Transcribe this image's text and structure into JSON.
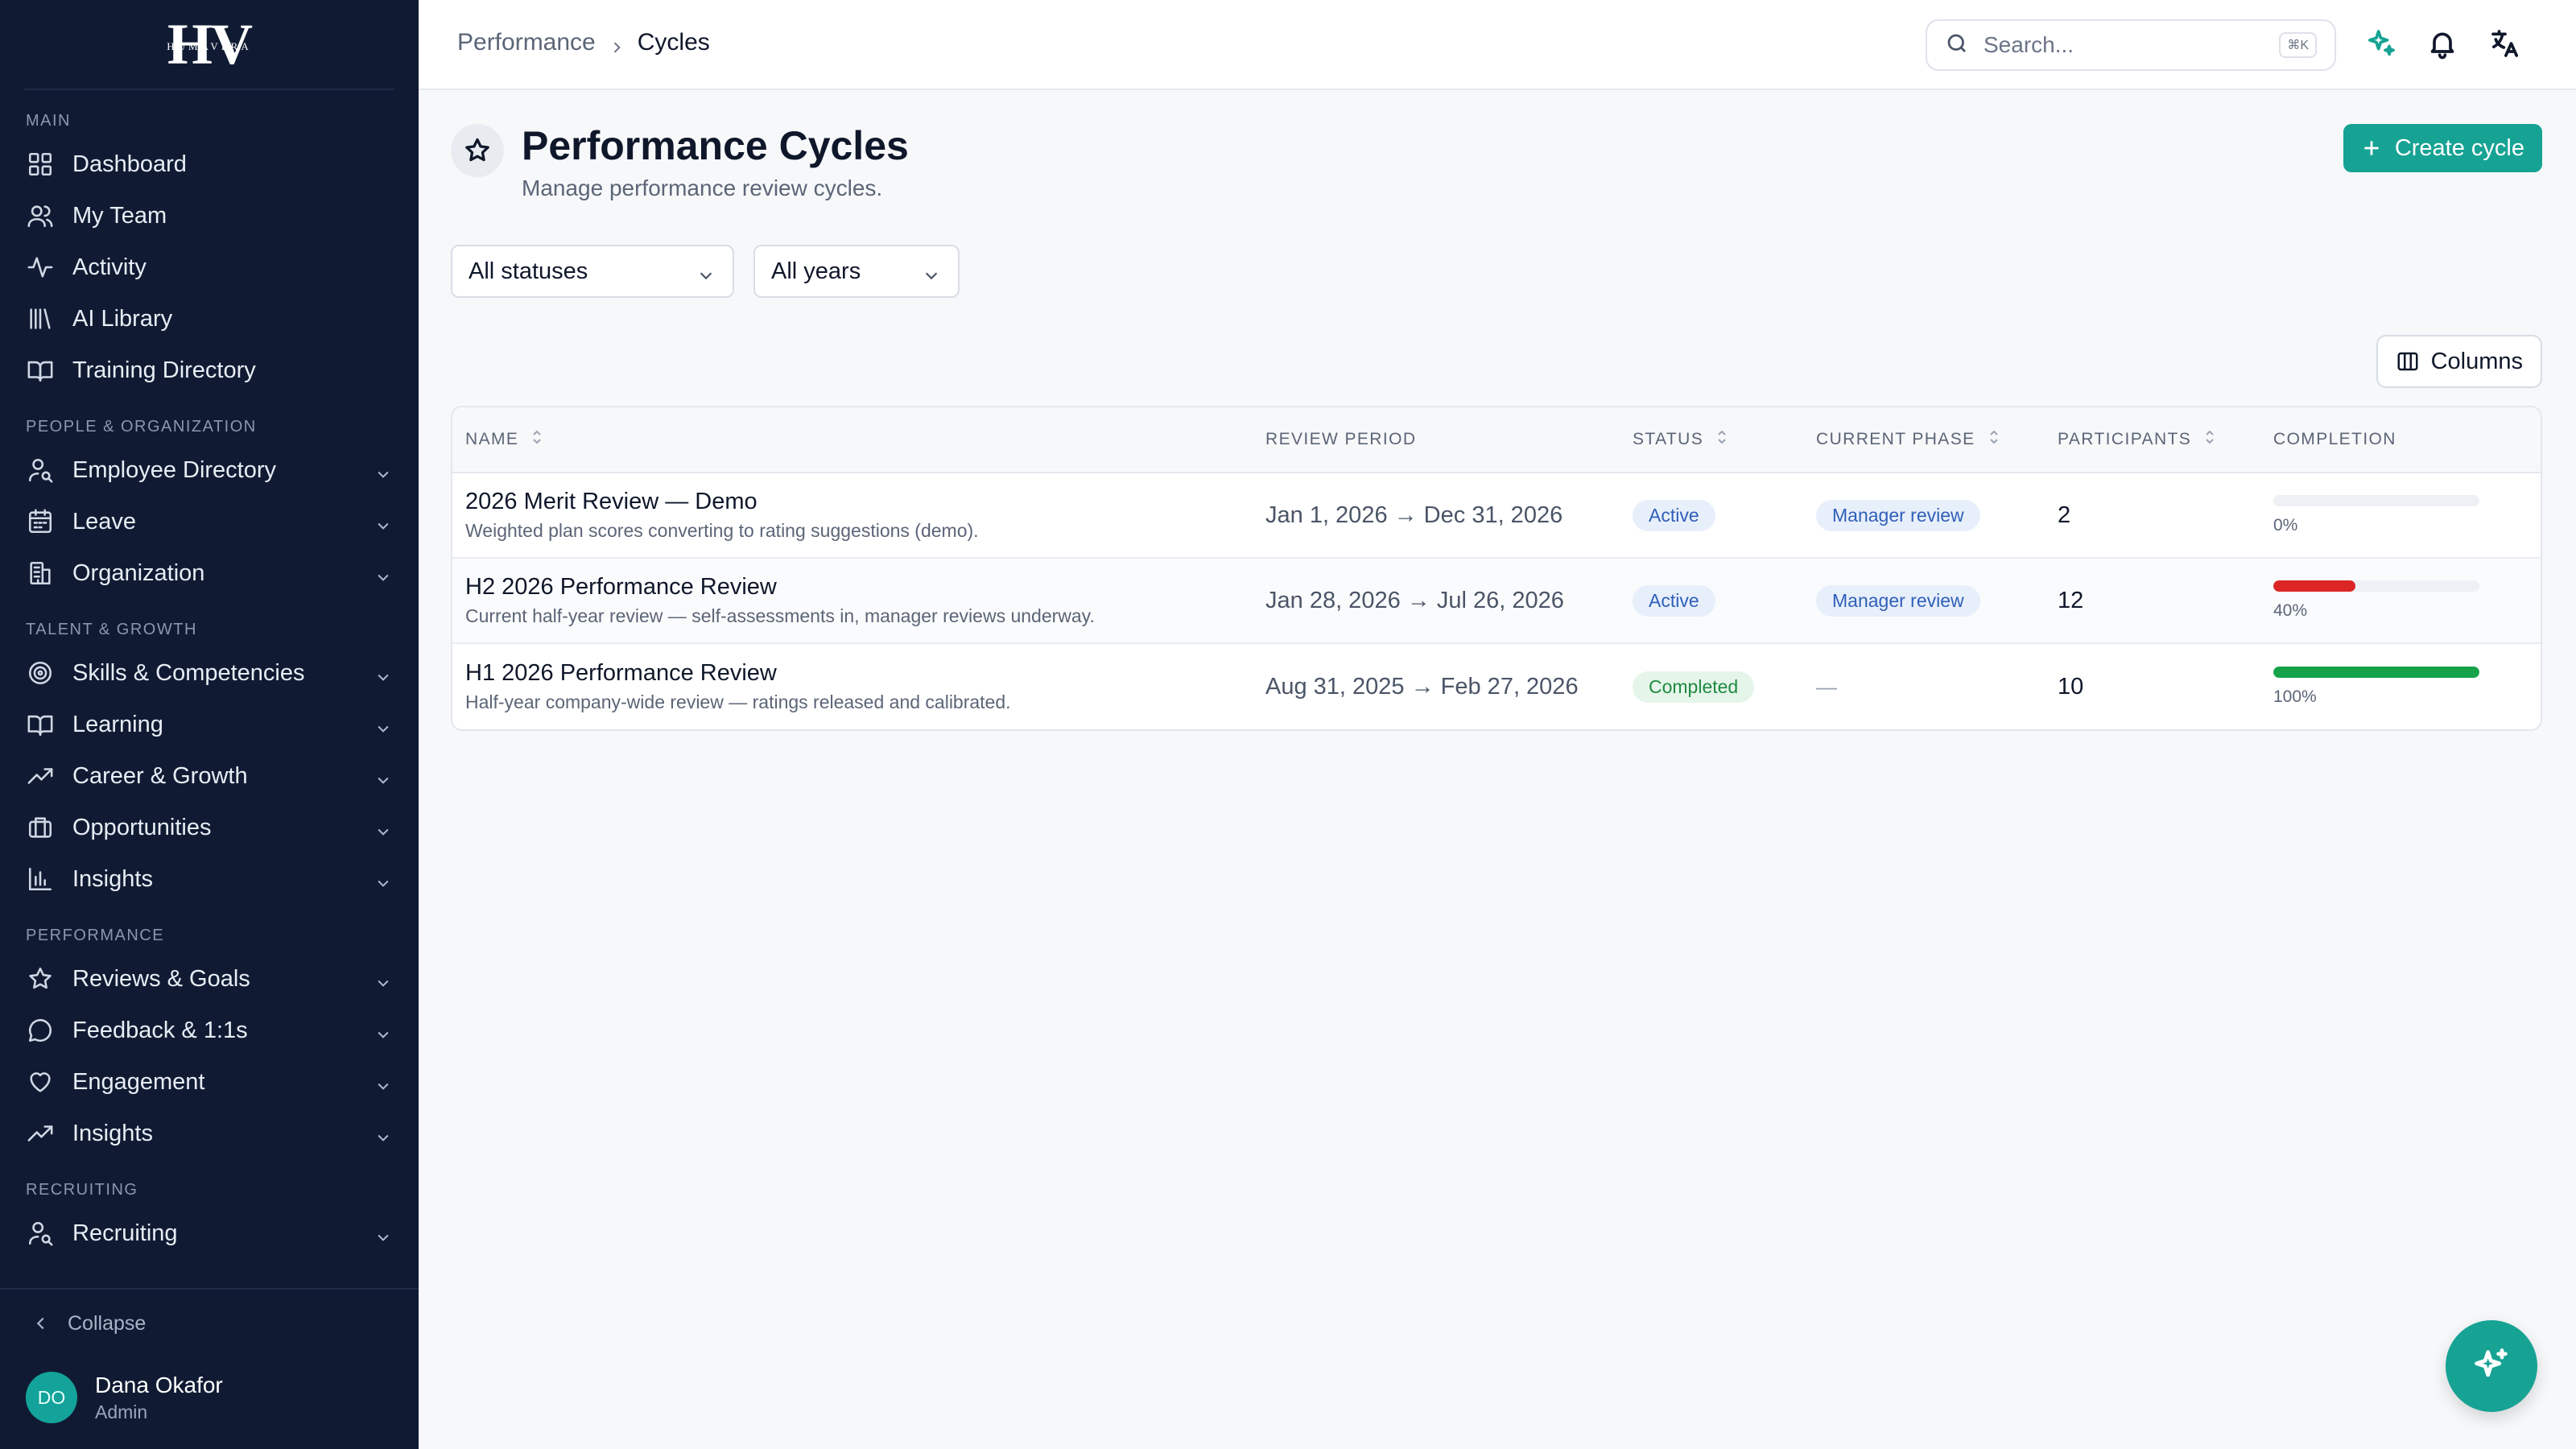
{
  "brand": {
    "monogram": "HV",
    "wordmark": "HUMAVERA"
  },
  "sidebar": {
    "sections": [
      {
        "title": "MAIN",
        "items": [
          {
            "label": "Dashboard",
            "icon": "grid-icon",
            "expandable": false
          },
          {
            "label": "My Team",
            "icon": "users-icon",
            "expandable": false
          },
          {
            "label": "Activity",
            "icon": "activity-icon",
            "expandable": false
          },
          {
            "label": "AI Library",
            "icon": "library-icon",
            "expandable": false
          },
          {
            "label": "Training Directory",
            "icon": "book-open-icon",
            "expandable": false
          }
        ]
      },
      {
        "title": "PEOPLE & ORGANIZATION",
        "items": [
          {
            "label": "Employee Directory",
            "icon": "user-search-icon",
            "expandable": true
          },
          {
            "label": "Leave",
            "icon": "calendar-icon",
            "expandable": true
          },
          {
            "label": "Organization",
            "icon": "building-icon",
            "expandable": true
          }
        ]
      },
      {
        "title": "TALENT & GROWTH",
        "items": [
          {
            "label": "Skills & Competencies",
            "icon": "target-icon",
            "expandable": true
          },
          {
            "label": "Learning",
            "icon": "book-open-icon",
            "expandable": true
          },
          {
            "label": "Career & Growth",
            "icon": "trending-up-icon",
            "expandable": true
          },
          {
            "label": "Opportunities",
            "icon": "briefcase-icon",
            "expandable": true
          },
          {
            "label": "Insights",
            "icon": "bar-chart-icon",
            "expandable": true
          }
        ]
      },
      {
        "title": "PERFORMANCE",
        "items": [
          {
            "label": "Reviews & Goals",
            "icon": "star-icon",
            "expandable": true
          },
          {
            "label": "Feedback & 1:1s",
            "icon": "message-circle-icon",
            "expandable": true
          },
          {
            "label": "Engagement",
            "icon": "heart-icon",
            "expandable": true
          },
          {
            "label": "Insights",
            "icon": "trending-up-icon",
            "expandable": true
          }
        ]
      },
      {
        "title": "RECRUITING",
        "items": [
          {
            "label": "Recruiting",
            "icon": "user-search-icon",
            "expandable": true
          }
        ]
      }
    ],
    "collapse_label": "Collapse",
    "user": {
      "initials": "DO",
      "name": "Dana Okafor",
      "role": "Admin"
    }
  },
  "topbar": {
    "breadcrumb": [
      "Performance",
      "Cycles"
    ],
    "search": {
      "placeholder": "Search...",
      "shortcut": "⌘K"
    }
  },
  "header": {
    "title": "Performance Cycles",
    "subtitle": "Manage performance review cycles.",
    "create_label": "Create cycle"
  },
  "filters": {
    "status": "All statuses",
    "year": "All years"
  },
  "columns_label": "Columns",
  "table": {
    "headers": [
      "NAME",
      "REVIEW PERIOD",
      "STATUS",
      "CURRENT PHASE",
      "PARTICIPANTS",
      "COMPLETION"
    ],
    "rows": [
      {
        "name": "2026 Merit Review — Demo",
        "description": "Weighted plan scores converting to rating suggestions (demo).",
        "period": "Jan 1, 2026 → Dec 31, 2026",
        "status": "Active",
        "phase": "Manager review",
        "participants": "2",
        "completion": 0,
        "completion_label": "0%",
        "bar_color": "#e5e7eb"
      },
      {
        "name": "H2 2026 Performance Review",
        "description": "Current half-year review — self-assessments in, manager reviews underway.",
        "period": "Jan 28, 2026 → Jul 26, 2026",
        "status": "Active",
        "phase": "Manager review",
        "participants": "12",
        "completion": 40,
        "completion_label": "40%",
        "bar_color": "#dc2626"
      },
      {
        "name": "H1 2026 Performance Review",
        "description": "Half-year company-wide review — ratings released and calibrated.",
        "period": "Aug 31, 2025 → Feb 27, 2026",
        "status": "Completed",
        "phase": "—",
        "participants": "10",
        "completion": 100,
        "completion_label": "100%",
        "bar_color": "#16a34a"
      }
    ]
  },
  "colors": {
    "accent": "#16a394",
    "sidebar_bg": "#101b33"
  }
}
